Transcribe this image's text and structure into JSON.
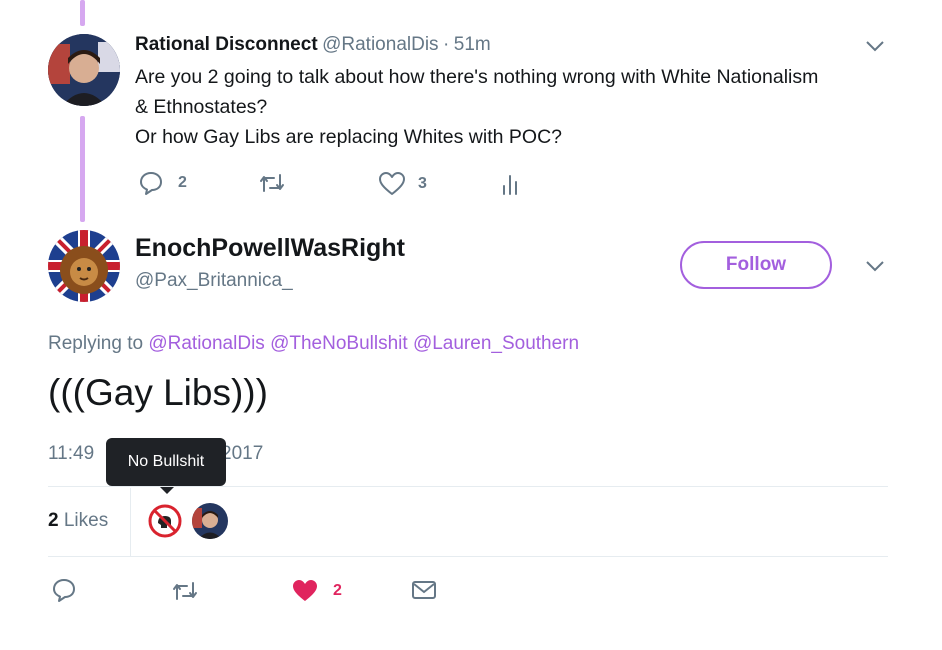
{
  "reply_tweet": {
    "display_name": "Rational Disconnect",
    "handle": "@RationalDis",
    "separator": "·",
    "time": "51m",
    "text_lines": [
      "Are you 2 going to talk about how there's nothing wrong with White Nationalism",
      "& Ethnostates?",
      "Or how Gay Libs are replacing Whites with POC?"
    ],
    "reply_count": "2",
    "retweet_count": "",
    "like_count": "3",
    "avatar_icon": "person-avatar"
  },
  "main_tweet": {
    "display_name": "EnochPowellWasRight",
    "handle": "@Pax_Britannica_",
    "follow_label": "Follow",
    "replying_prefix": "Replying to",
    "replying_to": [
      "@RationalDis",
      "@TheNoBullshit",
      "@Lauren_Southern"
    ],
    "text": "(((Gay Libs)))",
    "timestamp_left": "11:49",
    "timestamp_right": "2017",
    "tooltip": "No Bullshit",
    "likes_count": "2",
    "likes_label": "Likes",
    "bottom_like_count": "2",
    "avatar_icon": "lion-flag-avatar"
  },
  "colors": {
    "accent": "#a35fde",
    "like_red": "#e0245e",
    "muted": "#657786",
    "thread_line": "#d6a8f0"
  }
}
